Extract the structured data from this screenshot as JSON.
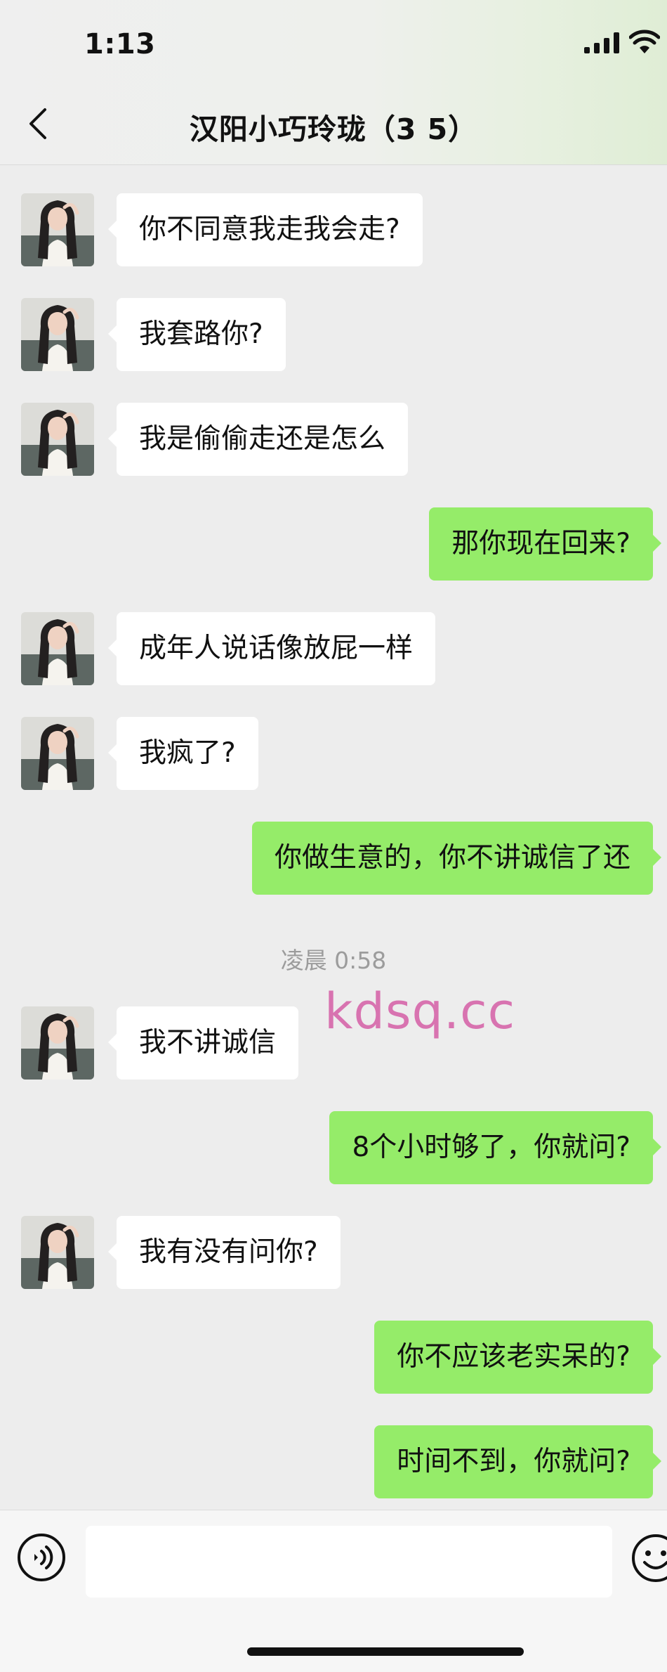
{
  "status_bar": {
    "time": "1:13"
  },
  "header": {
    "title": "汉阳小巧玲珑（3  5）"
  },
  "messages": [
    {
      "text": "你不同意我走我会走?"
    },
    {
      "text": "我套路你?"
    },
    {
      "text": "我是偷偷走还是怎么"
    },
    {
      "text": "那你现在回来?"
    },
    {
      "text": "成年人说话像放屁一样"
    },
    {
      "text": "我疯了?"
    },
    {
      "text": "你做生意的，你不讲诚信了还"
    },
    {
      "text": "我不讲诚信"
    },
    {
      "text": "8个小时够了，你就问?"
    },
    {
      "text": "我有没有问你?"
    },
    {
      "text": "你不应该老实呆的?"
    },
    {
      "text": "时间不到，你就问?"
    }
  ],
  "timestamp": "凌晨 0:58",
  "watermark": "kdsq.cc",
  "input": {
    "placeholder": ""
  },
  "colors": {
    "outgoing_bubble": "#95ec69",
    "incoming_bubble": "#ffffff",
    "background": "#ededed",
    "watermark": "#d873b0"
  }
}
